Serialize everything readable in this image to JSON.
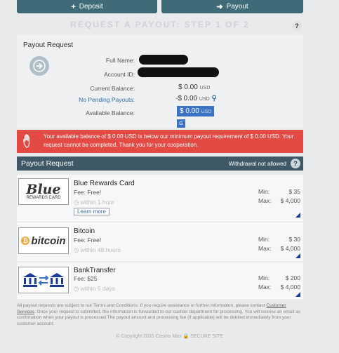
{
  "top": {
    "deposit_label": "Deposit",
    "payout_label": "Payout"
  },
  "step_title": "REQUEST A PAYOUT: STEP 1 OF 2",
  "help_label": "?",
  "account": {
    "section_title": "Payout Request",
    "full_name_label": "Full Name:",
    "account_id_label": "Account ID:",
    "current_balance_label": "Current Balance:",
    "current_balance_value": "$ 0.00",
    "pending_label": "No Pending Payouts:",
    "pending_value": "-$ 0.00",
    "available_label": "Available Balance:",
    "available_value": "$ 0.00",
    "currency": "USD"
  },
  "alert": {
    "text": "Your available balance of $ 0.00 USD is below our minimum payout requirement of $ 0.00 USD. Your request cannot be completed. Thank you for your cooperation."
  },
  "payout_header": {
    "title": "Payout Request",
    "status": "Withdrawal not allowed"
  },
  "min_label": "Min:",
  "max_label": "Max:",
  "methods": [
    {
      "name": "Blue Rewards Card",
      "logo_main": "Blue",
      "logo_sub": "REWARDS CARD",
      "fee": "Fee: Free!",
      "time": "within 1 hour",
      "learn_more": "Learn more",
      "min": "$ 35",
      "max": "$ 4,000"
    },
    {
      "name": "Bitcoin",
      "logo_main": "bitcoin",
      "fee": "Fee: Free!",
      "time": "within 48 hours",
      "min": "$ 30",
      "max": "$ 4,000"
    },
    {
      "name": "BankTransfer",
      "fee": "Fee: $25",
      "time": "within 5 days",
      "min": "$ 200",
      "max": "$ 4,000"
    }
  ],
  "footer": {
    "terms_text": "All payout requests are subject to our Terms and Conditions. If you require assistance or further information, please contact",
    "terms_link": "Customer Services",
    "terms_rest": ". Once your request is submitted, the information is forwarded to our cashier department for processing. You will receive an email as confirmation when your payout is processed.The payout amount and processing fee (if applicable) will be debited immediately from your customer account.",
    "copyright": "© Copyright 2026 Casino Max",
    "secure": "SECURE SITE"
  },
  "colors": {
    "accent": "#3f6b78",
    "alert": "#e34a44",
    "header": "#3e5866",
    "highlight": "#3a73c4"
  }
}
